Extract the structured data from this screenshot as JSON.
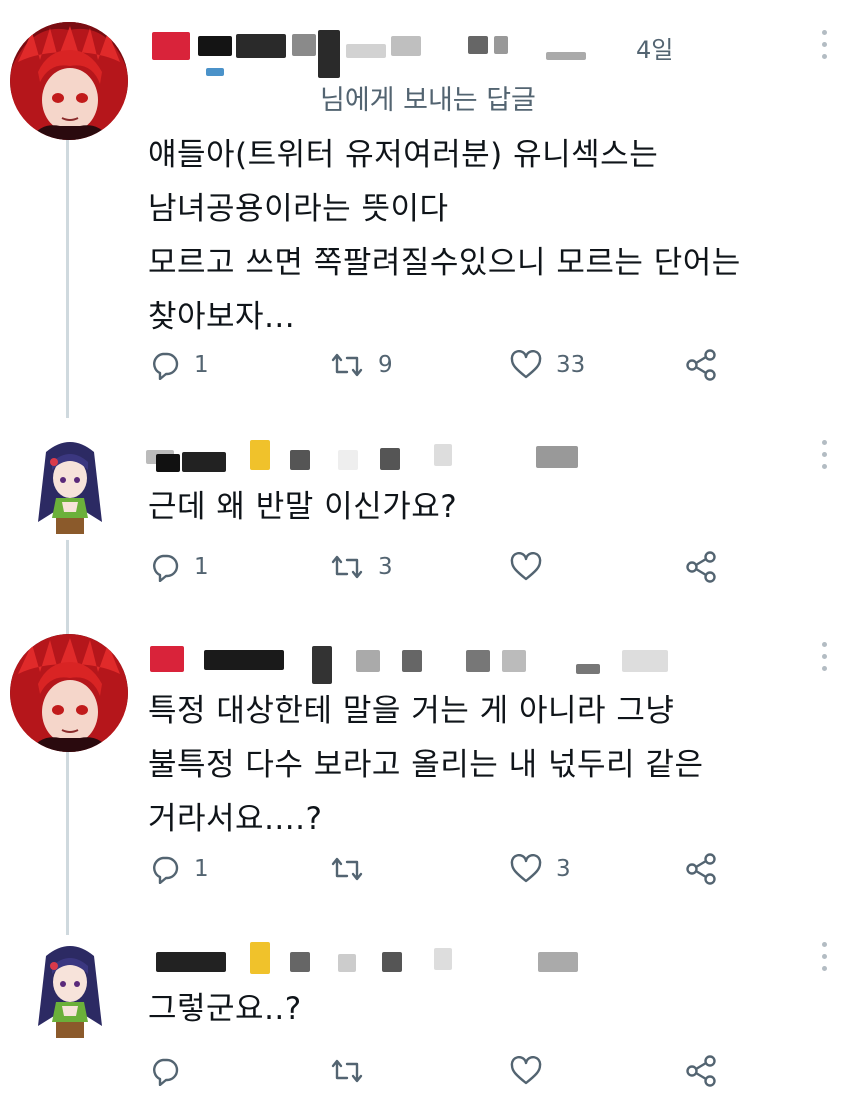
{
  "tweets": [
    {
      "time": "4일",
      "reply_to": "님에게 보내는 답글",
      "text": "얘들아(트위터 유저여러분) 유니섹스는\n남녀공용이라는 뜻이다\n모르고 쓰면 쪽팔려질수있으니 모르는 단어는\n찾아보자...",
      "reply_count": "1",
      "retweet_count": "9",
      "like_count": "33"
    },
    {
      "time": "",
      "reply_to": "",
      "text": "근데 왜 반말 이신가요?",
      "reply_count": "1",
      "retweet_count": "3",
      "like_count": ""
    },
    {
      "time": "",
      "reply_to": "",
      "text": "특정 대상한테 말을 거는 게 아니라 그냥\n불특정 다수 보라고 올리는 내 넋두리 같은\n거라서요....?",
      "reply_count": "1",
      "retweet_count": "",
      "like_count": "3"
    },
    {
      "time": "",
      "reply_to": "",
      "text": "그렇군요..?",
      "reply_count": "",
      "retweet_count": "",
      "like_count": ""
    }
  ],
  "icons": {
    "reply": "reply-icon",
    "retweet": "retweet-icon",
    "like": "heart-icon",
    "share": "share-icon",
    "more": "more-options-icon"
  },
  "colors": {
    "text": "#0f1419",
    "secondary": "#536471",
    "thread_line": "#cfd9de"
  }
}
